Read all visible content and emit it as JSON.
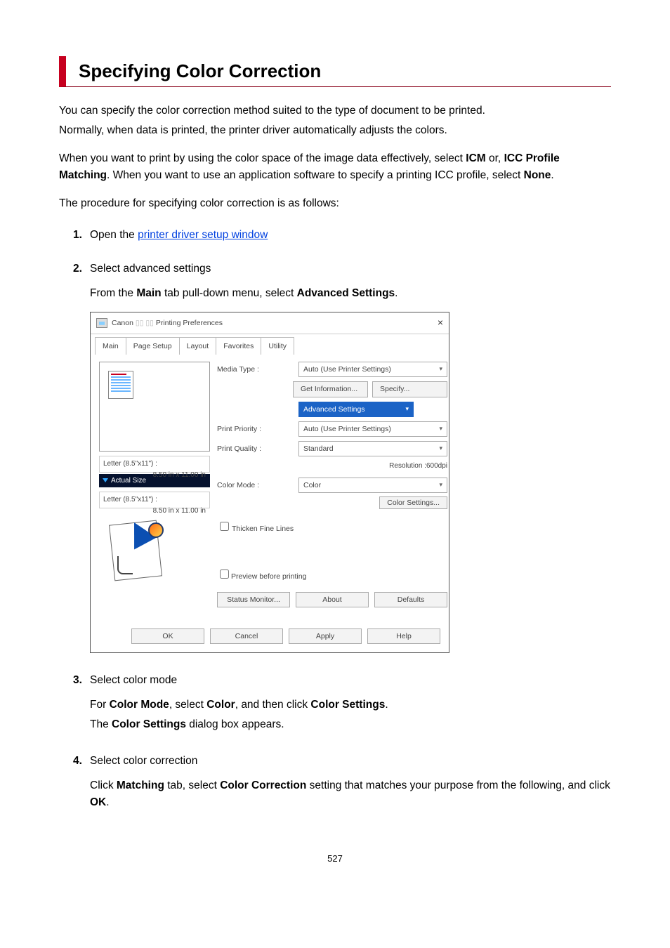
{
  "title": "Specifying Color Correction",
  "intro1": "You can specify the color correction method suited to the type of document to be printed.",
  "intro2": "Normally, when data is printed, the printer driver automatically adjusts the colors.",
  "intro3a": "When you want to print by using the color space of the image data effectively, select ",
  "intro3_icm": "ICM",
  "intro3b": " or, ",
  "intro3_icc": "ICC Profile Matching",
  "intro3c": ". When you want to use an application software to specify a printing ICC profile, select ",
  "intro3_none": "None",
  "intro3d": ".",
  "intro4": "The procedure for specifying color correction is as follows:",
  "steps": {
    "s1": {
      "head_a": "Open the ",
      "link": "printer driver setup window"
    },
    "s2": {
      "head": "Select advanced settings",
      "body_a": "From the ",
      "body_b": "Main",
      "body_c": " tab pull-down menu, select ",
      "body_d": "Advanced Settings",
      "body_e": "."
    },
    "s3": {
      "head": "Select color mode",
      "body_a": "For ",
      "body_b": "Color Mode",
      "body_c": ", select ",
      "body_d": "Color",
      "body_e": ", and then click ",
      "body_f": "Color Settings",
      "body_g": ".",
      "body2_a": "The ",
      "body2_b": "Color Settings",
      "body2_c": " dialog box appears."
    },
    "s4": {
      "head": "Select color correction",
      "body_a": "Click ",
      "body_b": "Matching",
      "body_c": " tab, select ",
      "body_d": "Color Correction",
      "body_e": " setting that matches your purpose from the following, and click ",
      "body_f": "OK",
      "body_g": "."
    }
  },
  "dialog": {
    "title_a": "Canon",
    "title_b": "Printing Preferences",
    "tabs": {
      "main": "Main",
      "pagesetup": "Page Setup",
      "layout": "Layout",
      "favorites": "Favorites",
      "utility": "Utility"
    },
    "media_type_label": "Media Type :",
    "media_type_value": "Auto (Use Printer Settings)",
    "get_info": "Get Information...",
    "specify": "Specify...",
    "advanced_settings": "Advanced Settings",
    "print_priority_label": "Print Priority :",
    "print_priority_value": "Auto (Use Printer Settings)",
    "print_quality_label": "Print Quality :",
    "print_quality_value": "Standard",
    "resolution": "Resolution :600dpi",
    "color_mode_label": "Color Mode :",
    "color_mode_value": "Color",
    "color_settings": "Color Settings...",
    "thicken": "Thicken Fine Lines",
    "preview_before": "Preview before printing",
    "paper1_label": "Letter (8.5\"x11\") :",
    "paper1_dim": "8.50 in x 11.00 in",
    "actual": "Actual Size",
    "paper2_label": "Letter (8.5\"x11\") :",
    "paper2_dim": "8.50 in x 11.00 in",
    "status_monitor": "Status Monitor...",
    "about": "About",
    "defaults": "Defaults",
    "ok": "OK",
    "cancel": "Cancel",
    "apply": "Apply",
    "help": "Help"
  },
  "page_number": "527"
}
